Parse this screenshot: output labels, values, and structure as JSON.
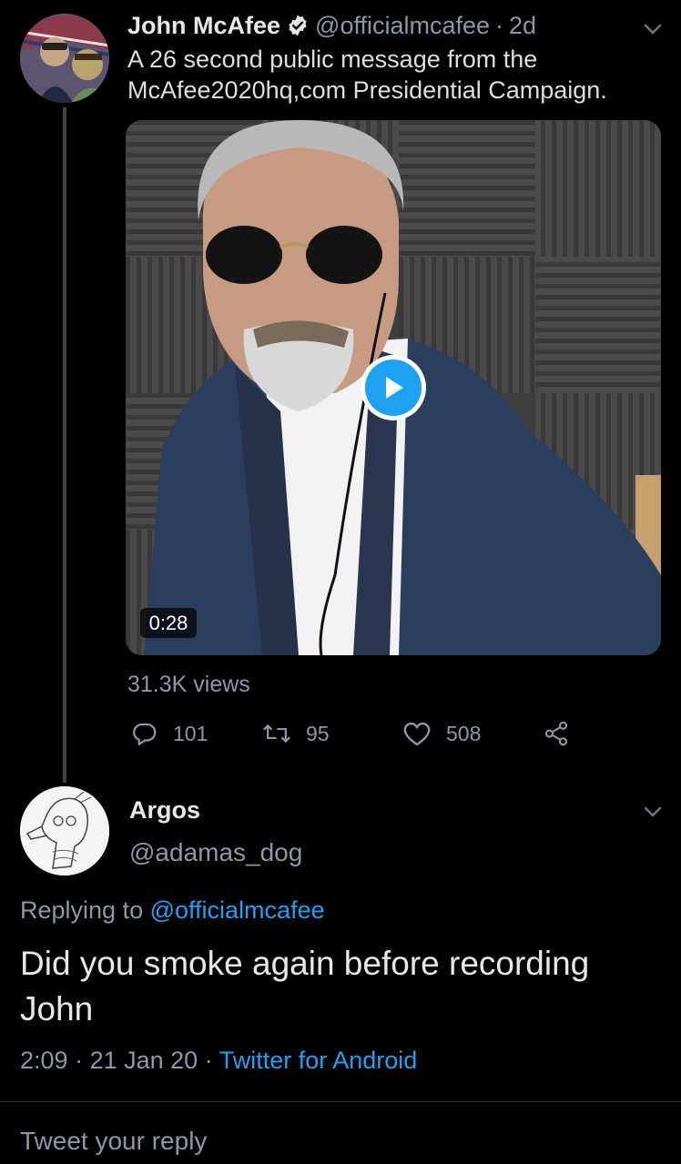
{
  "tweet": {
    "author_name": "John McAfee",
    "author_handle": "@officialmcafee",
    "separator": "·",
    "age": "2d",
    "text": "A 26 second public message from the McAfee2020hq,com Presidential Campaign.",
    "video_duration": "0:28",
    "views": "31.3K views",
    "replies": "101",
    "retweets": "95",
    "likes": "508"
  },
  "reply": {
    "author_name": "Argos",
    "author_handle": "@adamas_dog",
    "replying_prefix": "Replying to",
    "replying_to": "@officialmcafee",
    "text": "Did you smoke again before recording John",
    "time": "2:09",
    "date": "21 Jan 20",
    "source": "Twitter for Android"
  },
  "composer": {
    "placeholder": "Tweet your reply"
  },
  "colors": {
    "background": "#000000",
    "accent": "#1da1f2",
    "secondary_text": "#8b98a5"
  },
  "icons": [
    "verified-badge-icon",
    "chevron-down-icon",
    "play-icon",
    "reply-icon",
    "retweet-icon",
    "like-icon",
    "share-icon"
  ]
}
